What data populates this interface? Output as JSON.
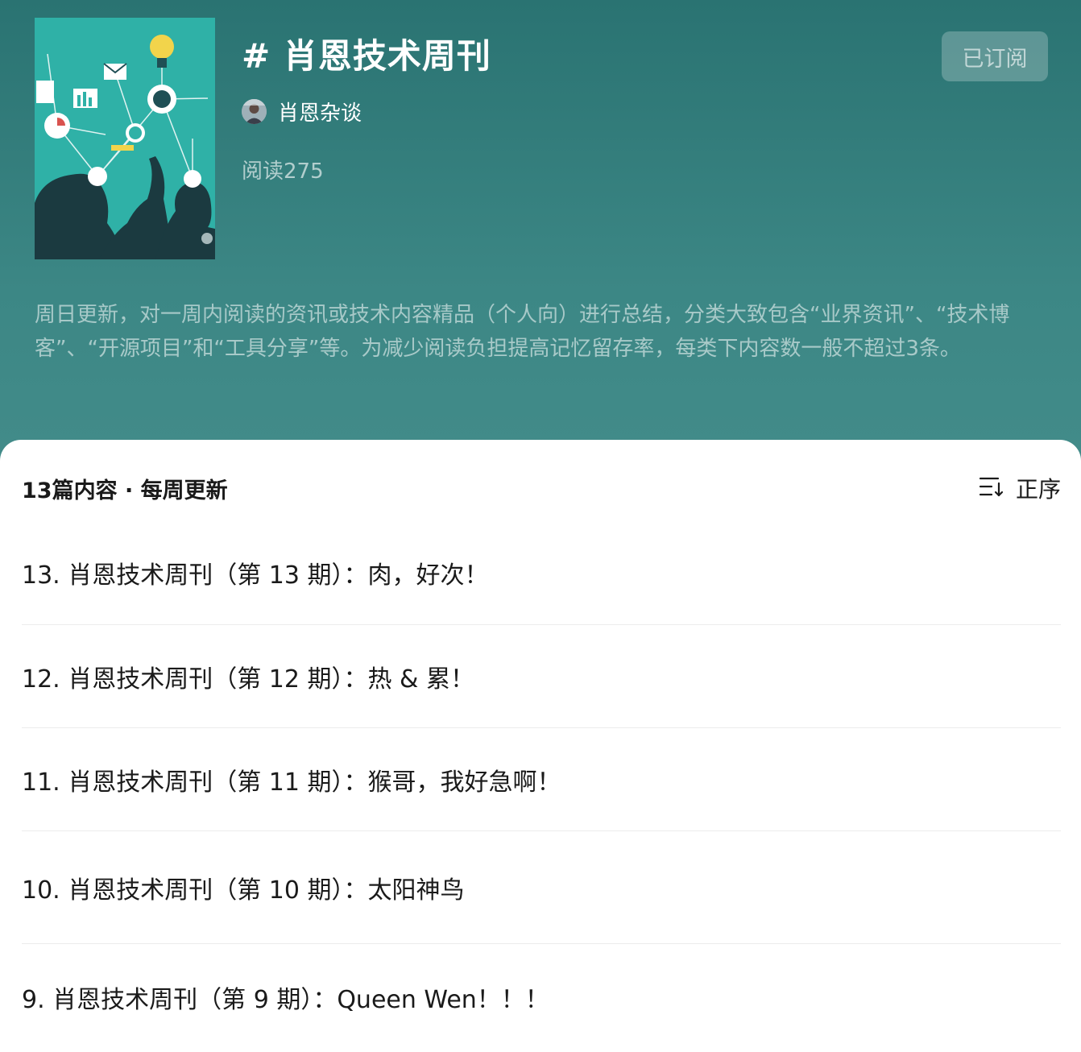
{
  "header": {
    "title": "# 肖恩技术周刊",
    "author": "肖恩杂谈",
    "reads": "阅读275",
    "subscribe_label": "已订阅",
    "description": "周日更新，对一周内阅读的资讯或技术内容精品（个人向）进行总结，分类大致包含“业界资讯”、“技术博客”、“开源项目”和“工具分享”等。为减少阅读负担提高记忆留存率，每类下内容数一般不超过3条。"
  },
  "list_header": {
    "count_label": "13篇内容 · 每周更新",
    "sort_label": "正序",
    "sort_icon": "sort-icon"
  },
  "articles": [
    {
      "title": "13. 肖恩技术周刊（第 13 期）：肉，好次！"
    },
    {
      "title": "12. 肖恩技术周刊（第 12 期）：热 & 累！"
    },
    {
      "title": "11. 肖恩技术周刊（第 11 期）：猴哥，我好急啊！"
    },
    {
      "title": "10. 肖恩技术周刊（第 10 期）：太阳神鸟"
    },
    {
      "title": "9. 肖恩技术周刊（第 9 期）：Queen Wen！！！"
    }
  ],
  "colors": {
    "header_bg": "#2a7372",
    "cover_bg": "#2fb1a7"
  }
}
